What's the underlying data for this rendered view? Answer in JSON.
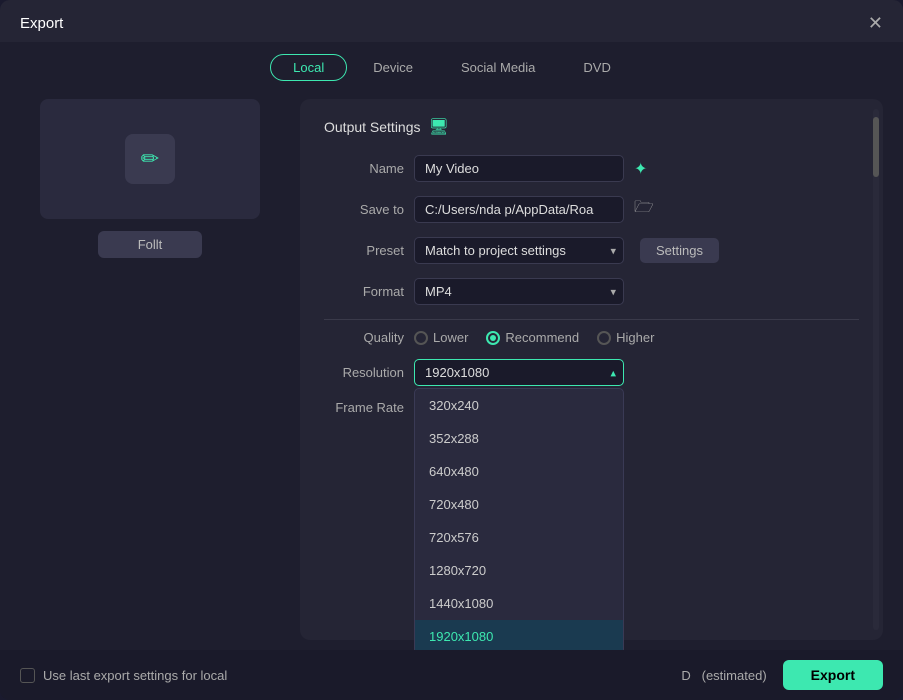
{
  "dialog": {
    "title": "Export",
    "close_label": "✕"
  },
  "tabs": [
    {
      "id": "local",
      "label": "Local",
      "active": true
    },
    {
      "id": "device",
      "label": "Device",
      "active": false
    },
    {
      "id": "social-media",
      "label": "Social Media",
      "active": false
    },
    {
      "id": "dvd",
      "label": "DVD",
      "active": false
    }
  ],
  "preview": {
    "edit_button_label": "Follt"
  },
  "output_settings": {
    "section_title": "Output Settings",
    "name_label": "Name",
    "name_value": "My Video",
    "save_to_label": "Save to",
    "save_to_value": "C:/Users/nda p/AppData/Roa",
    "preset_label": "Preset",
    "preset_value": "Match to project settings",
    "settings_button_label": "Settings",
    "format_label": "Format",
    "format_value": "MP4",
    "quality_label": "Quality",
    "quality_options": [
      {
        "id": "lower",
        "label": "Lower",
        "active": false
      },
      {
        "id": "recommend",
        "label": "Recommend",
        "active": true
      },
      {
        "id": "higher",
        "label": "Higher",
        "active": false
      }
    ],
    "resolution_label": "Resolution",
    "resolution_value": "1920x1080",
    "resolution_options": [
      {
        "value": "320x240",
        "label": "320x240"
      },
      {
        "value": "352x288",
        "label": "352x288"
      },
      {
        "value": "640x480",
        "label": "640x480"
      },
      {
        "value": "720x480",
        "label": "720x480"
      },
      {
        "value": "720x576",
        "label": "720x576"
      },
      {
        "value": "1280x720",
        "label": "1280x720"
      },
      {
        "value": "1440x1080",
        "label": "1440x1080"
      },
      {
        "value": "1920x1080",
        "label": "1920x1080",
        "selected": true
      }
    ],
    "frame_rate_label": "Frame Rate",
    "toggle1_on": true,
    "toggle2_on": false
  },
  "bottom": {
    "checkbox_label": "Use last export settings for local",
    "estimated_label": "D",
    "estimated_suffix": "(estimated)",
    "export_button_label": "Export"
  },
  "icons": {
    "close": "✕",
    "ai": "✦",
    "folder": "🗁",
    "settings_icon": "⚙",
    "chevron_down": "▾",
    "chevron_up": "▴"
  }
}
